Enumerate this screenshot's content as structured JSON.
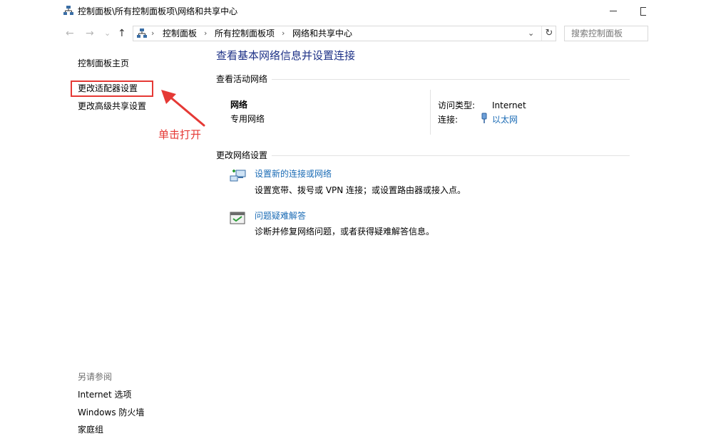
{
  "window": {
    "title": "控制面板\\所有控制面板项\\网络和共享中心"
  },
  "nav": {
    "back_glyph": "←",
    "forward_glyph": "→",
    "recent_glyph": "⌄",
    "up_glyph": "↑",
    "breadcrumbs": [
      "控制面板",
      "所有控制面板项",
      "网络和共享中心"
    ],
    "breadcrumb_sep": "›",
    "dropdown_glyph": "⌄",
    "refresh_glyph": "↻"
  },
  "search": {
    "placeholder": "搜索控制面板"
  },
  "sidebar": {
    "home": "控制面板主页",
    "change_adapter": "更改适配器设置",
    "advanced_sharing": "更改高级共享设置",
    "see_also_title": "另请参阅",
    "see_also": [
      "Internet 选项",
      "Windows 防火墙",
      "家庭组"
    ]
  },
  "annotation": {
    "text": "单击打开",
    "color": "#e53935"
  },
  "main": {
    "title": "查看基本网络信息并设置连接",
    "active_networks_label": "查看活动网络",
    "network": {
      "name": "网络",
      "type": "专用网络",
      "access_type_label": "访问类型:",
      "access_type_value": "Internet",
      "connection_label": "连接:",
      "connection_value": "以太网"
    },
    "change_settings_label": "更改网络设置",
    "tasks": [
      {
        "link": "设置新的连接或网络",
        "desc": "设置宽带、拨号或 VPN 连接；或设置路由器或接入点。"
      },
      {
        "link": "问题疑难解答",
        "desc": "诊断并修复网络问题，或者获得疑难解答信息。"
      }
    ]
  },
  "colors": {
    "title_blue": "#1e3287",
    "link_blue": "#1a6bb5",
    "highlight_red": "#e53935"
  }
}
